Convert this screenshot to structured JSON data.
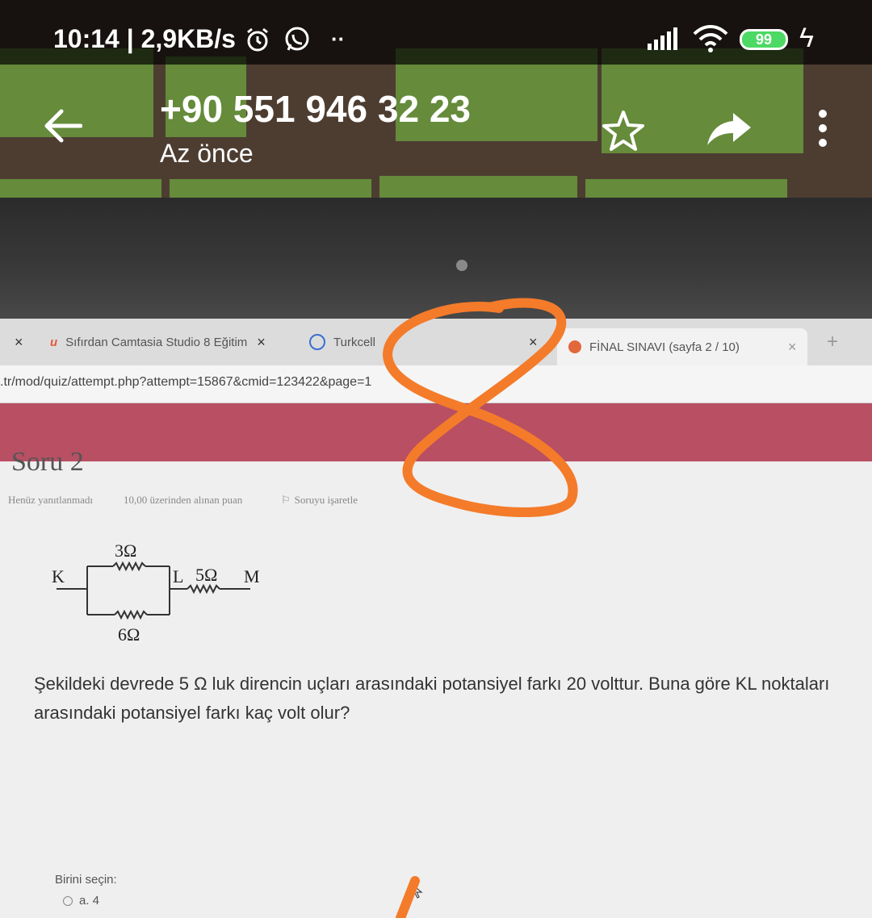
{
  "status_bar": {
    "time_speed": "10:14 | 2,9KB/s",
    "battery_level": "99",
    "icons": [
      "alarm-icon",
      "whatsapp-icon",
      "more-dots-icon",
      "signal-icon",
      "wifi-icon",
      "battery-icon",
      "charging-icon"
    ]
  },
  "app_bar": {
    "title": "+90 551 946 32 23",
    "subtitle": "Az önce",
    "icons": [
      "back-arrow-icon",
      "star-icon",
      "share-icon",
      "overflow-menu-icon"
    ]
  },
  "browser": {
    "tabs": [
      {
        "label": "Sıfırdan Camtasia Studio 8 Eğitim",
        "close": "×",
        "icon": "udemy-icon"
      },
      {
        "label": "Turkcell",
        "close": "×",
        "icon": "turkcell-icon"
      },
      {
        "label": "FİNAL SINAVI (sayfa 2 / 10)",
        "close": "×",
        "icon": "moodle-icon"
      }
    ],
    "new_tab": "+",
    "url": ".tr/mod/quiz/attempt.php?attempt=15867&cmid=123422&page=1"
  },
  "quiz": {
    "question_title": "Soru 2",
    "status": "Henüz yanıtlanmadı",
    "points": "10,00 üzerinden alınan puan",
    "flag_label": "Soruyu işaretle",
    "circuit": {
      "r_top": "3Ω",
      "r_bottom": "6Ω",
      "r_series": "5Ω",
      "node_k": "K",
      "node_l": "L",
      "node_m": "M"
    },
    "question_text": "Şekildeki devrede 5 Ω luk direncin uçları arasındaki potansiyel farkı 20 volttur. Buna göre KL noktaları arasındaki potansiyel farkı kaç volt olur?",
    "choose_label": "Birini seçin:",
    "option_a": "a. 4"
  },
  "annotation": {
    "drawn_text": "8",
    "color": "#f47b2a"
  }
}
